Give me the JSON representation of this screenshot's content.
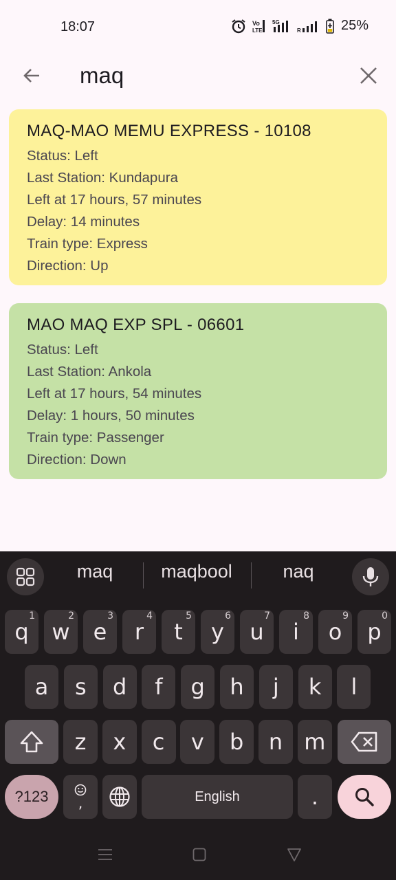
{
  "status_bar": {
    "time": "18:07",
    "battery": "25%"
  },
  "search": {
    "query": "maq"
  },
  "results": [
    {
      "title": "MAQ-MAO MEMU EXPRESS - 10108",
      "lines": [
        "Status: Left",
        "Last Station: Kundapura",
        "Left at 17 hours, 57 minutes",
        "Delay: 14 minutes",
        "Train type: Express",
        "Direction: Up"
      ],
      "color": "#fdf29a"
    },
    {
      "title": "MAO MAQ EXP SPL - 06601",
      "lines": [
        "Status: Left",
        "Last Station: Ankola",
        "Left at 17 hours, 54 minutes",
        "Delay: 1 hours, 50 minutes",
        "Train type: Passenger",
        "Direction: Down"
      ],
      "color": "#c5e1a6"
    }
  ],
  "keyboard": {
    "suggestions": [
      "maq",
      "maqbool",
      "naq"
    ],
    "row1": [
      {
        "k": "q",
        "h": "1"
      },
      {
        "k": "w",
        "h": "2"
      },
      {
        "k": "e",
        "h": "3"
      },
      {
        "k": "r",
        "h": "4"
      },
      {
        "k": "t",
        "h": "5"
      },
      {
        "k": "y",
        "h": "6"
      },
      {
        "k": "u",
        "h": "7"
      },
      {
        "k": "i",
        "h": "8"
      },
      {
        "k": "o",
        "h": "9"
      },
      {
        "k": "p",
        "h": "0"
      }
    ],
    "row2": [
      "a",
      "s",
      "d",
      "f",
      "g",
      "h",
      "j",
      "k",
      "l"
    ],
    "row3": [
      "z",
      "x",
      "c",
      "v",
      "b",
      "n",
      "m"
    ],
    "symbols_label": "?123",
    "comma": ",",
    "space_label": "English",
    "period": "."
  }
}
